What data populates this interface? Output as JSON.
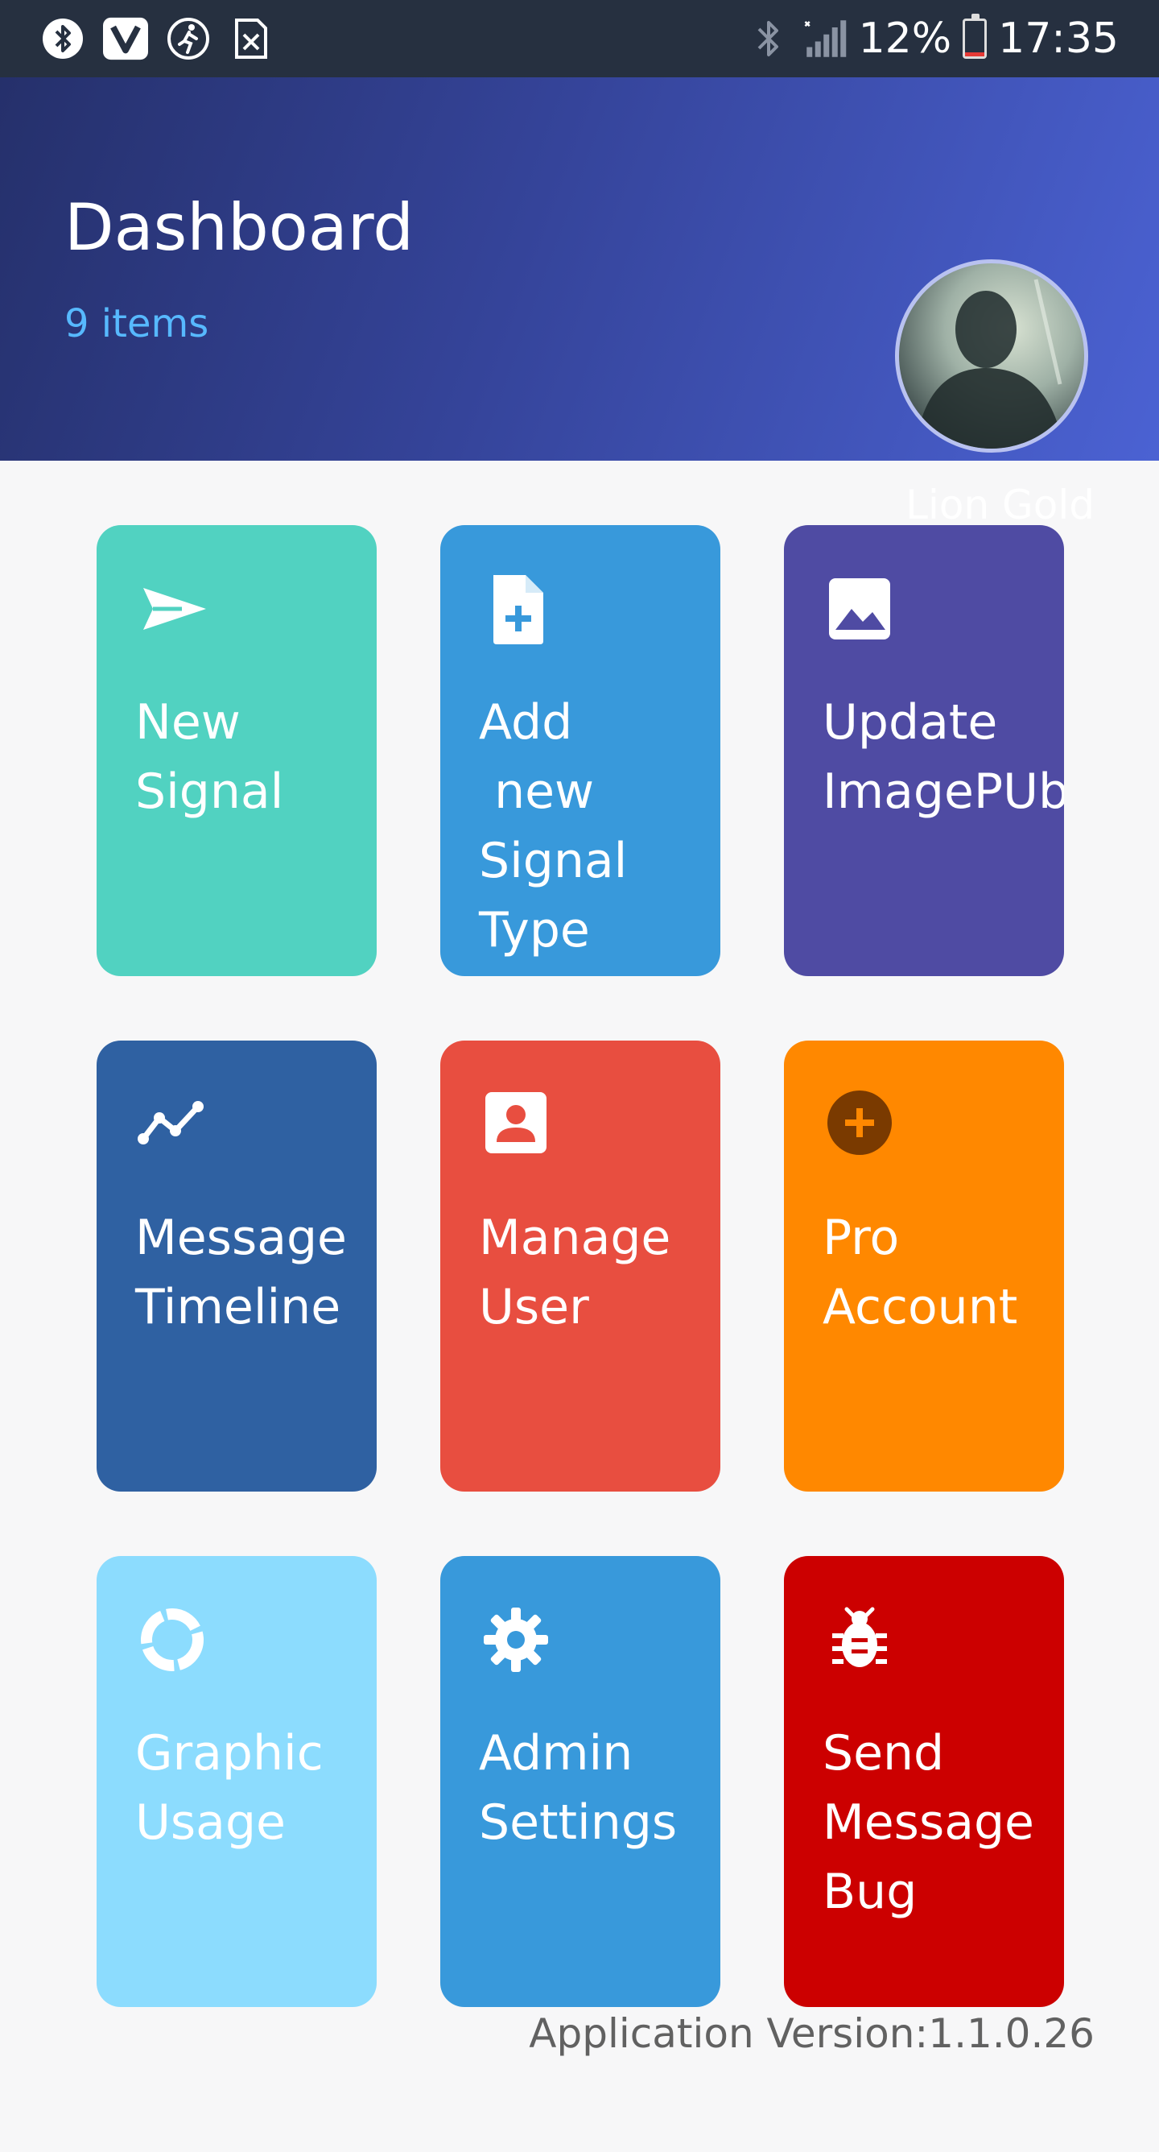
{
  "status_bar": {
    "icons": [
      "bluetooth-circle-icon",
      "vivaldi-icon",
      "activity-icon",
      "sim-off-icon"
    ],
    "battery_percent": "12%",
    "battery_level": 0.12,
    "time": "17:35"
  },
  "header": {
    "title": "Dashboard",
    "subtitle": "9 items",
    "username": "Lion Gold"
  },
  "tiles": [
    {
      "label": "New\nSignal",
      "icon": "send-icon",
      "color": "#51d2c1"
    },
    {
      "label": "Add\n new\nSignal\nType",
      "icon": "file-add-icon",
      "color": "#3899db"
    },
    {
      "label": "Update\nImagePUb",
      "icon": "image-icon",
      "color": "#4f4ba3"
    },
    {
      "label": "Message\nTimeline",
      "icon": "trend-line-icon",
      "color": "#2f61a2"
    },
    {
      "label": "Manage\nUser",
      "icon": "contact-card-icon",
      "color": "#e84e40"
    },
    {
      "label": "Pro\nAccount",
      "icon": "add-circle-icon",
      "color": "#ff8800"
    },
    {
      "label": "Graphic\nUsage",
      "icon": "donut-chart-icon",
      "color": "#8cdcfe"
    },
    {
      "label": "Admin\nSettings",
      "icon": "gear-icon",
      "color": "#3899db"
    },
    {
      "label": "Send\nMessage\nBug",
      "icon": "bug-icon",
      "color": "#cc0000"
    }
  ],
  "footer": {
    "version": "Application Version:1.1.0.26"
  }
}
